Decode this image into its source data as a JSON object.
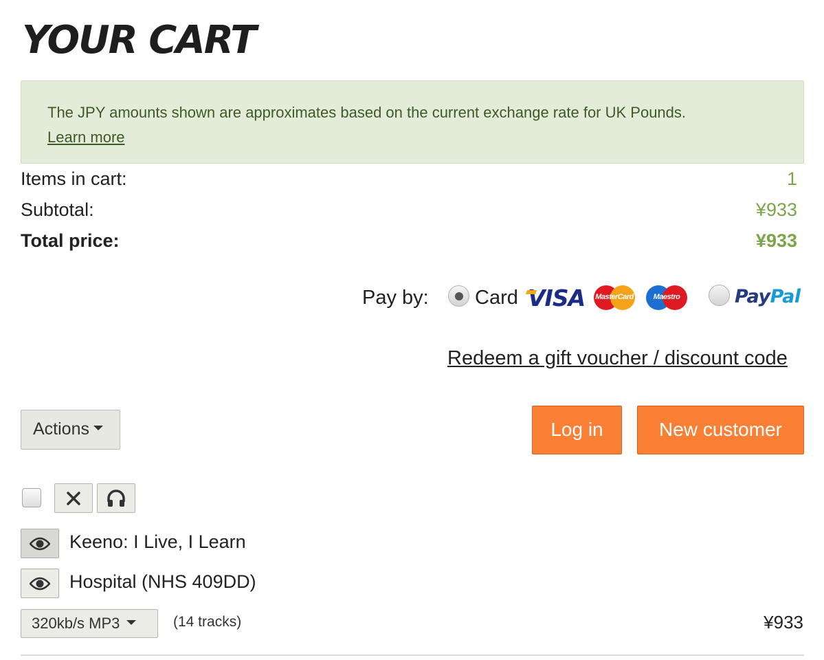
{
  "page": {
    "title": "YOUR CART"
  },
  "notice": {
    "text": "The JPY amounts shown are approximates based on the current exchange rate for UK Pounds.",
    "link": "Learn more",
    "color": "#e3ecd8"
  },
  "summary": {
    "items_label": "Items in cart:",
    "items_value": "1",
    "subtotal_label": "Subtotal:",
    "subtotal_value": "¥933",
    "total_label": "Total price:",
    "total_value": "¥933",
    "value_color": "#7aa54a"
  },
  "payment": {
    "label": "Pay by:",
    "card_label": "Card",
    "selected": "card",
    "logos": {
      "visa": "VISA",
      "mastercard": "MasterCard",
      "maestro": "Maestro",
      "paypal_1": "Pay",
      "paypal_2": "Pal"
    }
  },
  "redeem_link": "Redeem a gift voucher / discount code",
  "actions": {
    "actions_label": "Actions",
    "login_label": "Log in",
    "new_customer_label": "New customer",
    "accent": "#f97f34"
  },
  "cart": {
    "toolbar_icons": [
      "close-icon",
      "headphones-icon"
    ],
    "items": [
      {
        "text": "Keeno: I Live, I Learn",
        "icon": "eye-icon"
      },
      {
        "text": "Hospital (NHS 409DD)",
        "icon": "eye-icon"
      }
    ],
    "format": "320kb/s MP3",
    "tracks": "(14 tracks)",
    "price": "¥933"
  }
}
